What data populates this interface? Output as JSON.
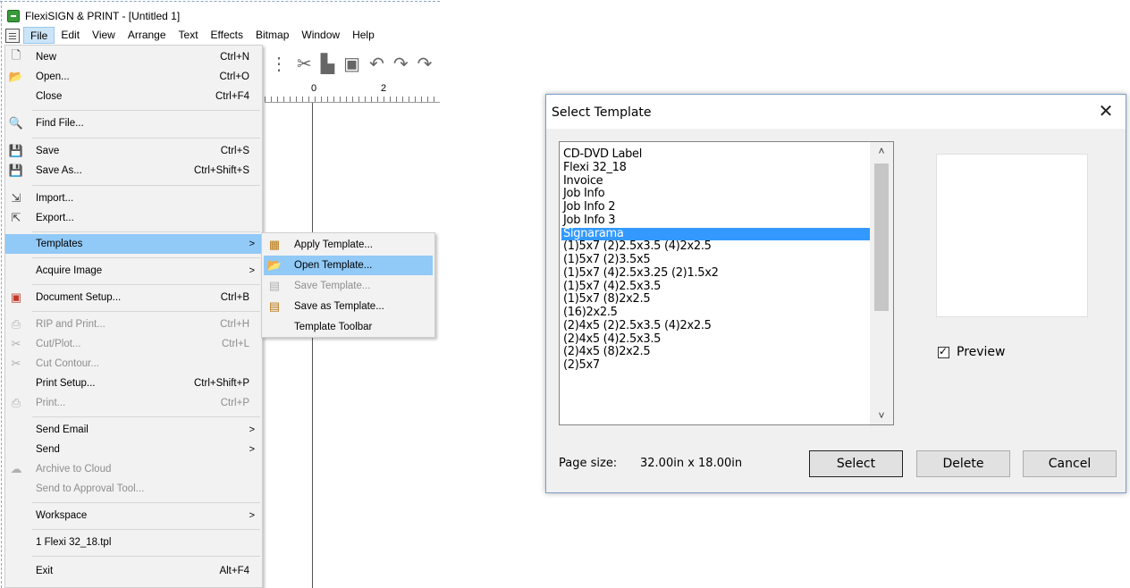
{
  "app": {
    "title": "FlexiSIGN & PRINT - [Untitled 1]",
    "menubar": [
      "File",
      "Edit",
      "View",
      "Arrange",
      "Text",
      "Effects",
      "Bitmap",
      "Window",
      "Help"
    ],
    "ruler": {
      "num0": "0",
      "num2": "2"
    }
  },
  "file_menu": {
    "items": [
      {
        "label": "New",
        "shortcut": "Ctrl+N",
        "icon": "new-doc-icon",
        "glyph": "🗋"
      },
      {
        "label": "Open...",
        "shortcut": "Ctrl+O",
        "icon": "open-folder-icon",
        "glyph": "📂"
      },
      {
        "label": "Close",
        "shortcut": "Ctrl+F4",
        "icon": "",
        "glyph": ""
      },
      {
        "label": "Find File...",
        "shortcut": "",
        "icon": "find-file-icon",
        "glyph": "🔍"
      },
      {
        "label": "Save",
        "shortcut": "Ctrl+S",
        "icon": "save-icon",
        "glyph": "💾"
      },
      {
        "label": "Save As...",
        "shortcut": "Ctrl+Shift+S",
        "icon": "save-as-icon",
        "glyph": "💾"
      },
      {
        "label": "Import...",
        "shortcut": "",
        "icon": "import-icon",
        "glyph": "⇲"
      },
      {
        "label": "Export...",
        "shortcut": "",
        "icon": "export-icon",
        "glyph": "⇱"
      },
      {
        "label": "Templates",
        "shortcut": "",
        "icon": "",
        "glyph": ""
      },
      {
        "label": "Acquire Image",
        "shortcut": "",
        "icon": "",
        "glyph": ""
      },
      {
        "label": "Document Setup...",
        "shortcut": "Ctrl+B",
        "icon": "document-setup-icon",
        "glyph": "▣"
      },
      {
        "label": "RIP and Print...",
        "shortcut": "Ctrl+H",
        "icon": "rip-print-icon",
        "glyph": "⎙"
      },
      {
        "label": "Cut/Plot...",
        "shortcut": "Ctrl+L",
        "icon": "cut-plot-icon",
        "glyph": "✂"
      },
      {
        "label": "Cut Contour...",
        "shortcut": "",
        "icon": "cut-contour-icon",
        "glyph": "✂"
      },
      {
        "label": "Print Setup...",
        "shortcut": "Ctrl+Shift+P",
        "icon": "",
        "glyph": ""
      },
      {
        "label": "Print...",
        "shortcut": "Ctrl+P",
        "icon": "print-icon",
        "glyph": "⎙"
      },
      {
        "label": "Send Email",
        "shortcut": "",
        "icon": "",
        "glyph": ""
      },
      {
        "label": "Send",
        "shortcut": "",
        "icon": "",
        "glyph": ""
      },
      {
        "label": "Archive to Cloud",
        "shortcut": "",
        "icon": "cloud-icon",
        "glyph": "☁"
      },
      {
        "label": "Send to Approval Tool...",
        "shortcut": "",
        "icon": "",
        "glyph": ""
      },
      {
        "label": "Workspace",
        "shortcut": "",
        "icon": "",
        "glyph": ""
      },
      {
        "label": "1 Flexi 32_18.tpl",
        "shortcut": "",
        "icon": "",
        "glyph": ""
      },
      {
        "label": "Exit",
        "shortcut": "Alt+F4",
        "icon": "",
        "glyph": ""
      }
    ],
    "submenu_arrow": ">"
  },
  "templates_submenu": {
    "items": [
      {
        "label": "Apply Template...",
        "icon": "apply-template-icon",
        "glyph": "▦"
      },
      {
        "label": "Open Template...",
        "icon": "open-template-icon",
        "glyph": "📂"
      },
      {
        "label": "Save Template...",
        "icon": "save-template-icon",
        "glyph": "▤"
      },
      {
        "label": "Save as Template...",
        "icon": "save-as-template-icon",
        "glyph": "▤"
      },
      {
        "label": "Template Toolbar",
        "icon": "",
        "glyph": ""
      }
    ]
  },
  "dialog": {
    "title": "Select Template",
    "close_glyph": "✕",
    "templates": [
      "CD-DVD Label",
      "Flexi 32_18",
      "Invoice",
      "Job Info",
      "Job Info 2",
      "Job Info 3",
      "Signarama",
      "(1)5x7 (2)2.5x3.5 (4)2x2.5",
      "(1)5x7 (2)3.5x5",
      "(1)5x7 (4)2.5x3.25 (2)1.5x2",
      "(1)5x7 (4)2.5x3.5",
      "(1)5x7 (8)2x2.5",
      "(16)2x2.5",
      "(2)4x5 (2)2.5x3.5 (4)2x2.5",
      "(2)4x5 (4)2.5x3.5",
      "(2)4x5 (8)2x2.5",
      "(2)5x7"
    ],
    "selected_template": "Signarama",
    "preview_label": "Preview",
    "preview_checked": true,
    "page_size_label": "Page size:",
    "page_size_value": "32.00in x 18.00in",
    "buttons": {
      "select": "Select",
      "delete": "Delete",
      "cancel": "Cancel"
    },
    "scroll_up": "˄",
    "scroll_down": "˅"
  }
}
